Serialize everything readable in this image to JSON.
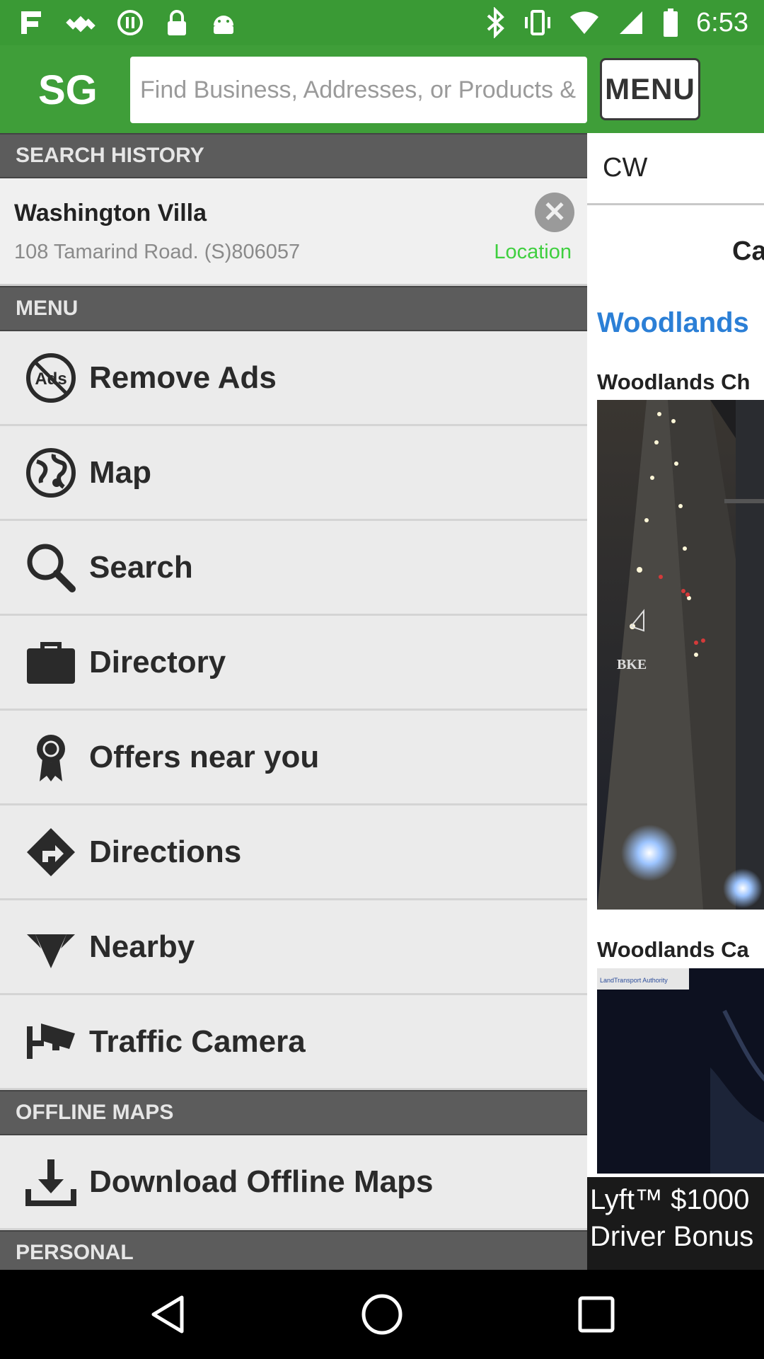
{
  "status_bar": {
    "time": "6:53",
    "left_icons": [
      "app-notification-icon",
      "fake-gps-icon",
      "pause-icon",
      "lock-icon",
      "android-icon"
    ],
    "right_icons": [
      "bluetooth-icon",
      "vibrate-icon",
      "wifi-icon",
      "signal-icon",
      "battery-icon"
    ]
  },
  "header": {
    "logo": "SG",
    "search_placeholder": "Find Business, Addresses, or Products & Se",
    "menu_button": "MENU"
  },
  "search_history": {
    "title": "SEARCH HISTORY",
    "item": {
      "title": "Washington Villa",
      "address": "108 Tamarind Road. (S)806057",
      "location_label": "Location"
    }
  },
  "menu": {
    "title": "MENU",
    "items": [
      {
        "label": "Remove Ads",
        "icon": "no-ads-icon"
      },
      {
        "label": "Map",
        "icon": "globe-icon"
      },
      {
        "label": "Search",
        "icon": "search-icon"
      },
      {
        "label": "Directory",
        "icon": "briefcase-icon"
      },
      {
        "label": "Offers near you",
        "icon": "award-ribbon-icon"
      },
      {
        "label": "Directions",
        "icon": "directions-sign-icon"
      },
      {
        "label": "Nearby",
        "icon": "nearby-arrows-icon"
      },
      {
        "label": "Traffic Camera",
        "icon": "cctv-camera-icon"
      }
    ]
  },
  "offline_maps": {
    "title": "OFFLINE MAPS",
    "items": [
      {
        "label": "Download Offline Maps",
        "icon": "download-icon"
      }
    ]
  },
  "personal": {
    "title": "PERSONAL"
  },
  "right_panel": {
    "query": "CW",
    "partial_title": "Ca",
    "area_heading": "Woodlands",
    "camera_1_label": "Woodlands Ch",
    "camera_1_sign_text": "BKE",
    "camera_2_label": "Woodlands Ca",
    "camera_2_logo_text": "LandTransport Authority",
    "ad_line_1": "Lyft™ $1000",
    "ad_line_2": "Driver Bonus"
  },
  "colors": {
    "header_green": "#3f9e39",
    "section_header": "#5c5c5c",
    "location_green": "#3fcf3f",
    "area_blue": "#2b7fd6"
  }
}
